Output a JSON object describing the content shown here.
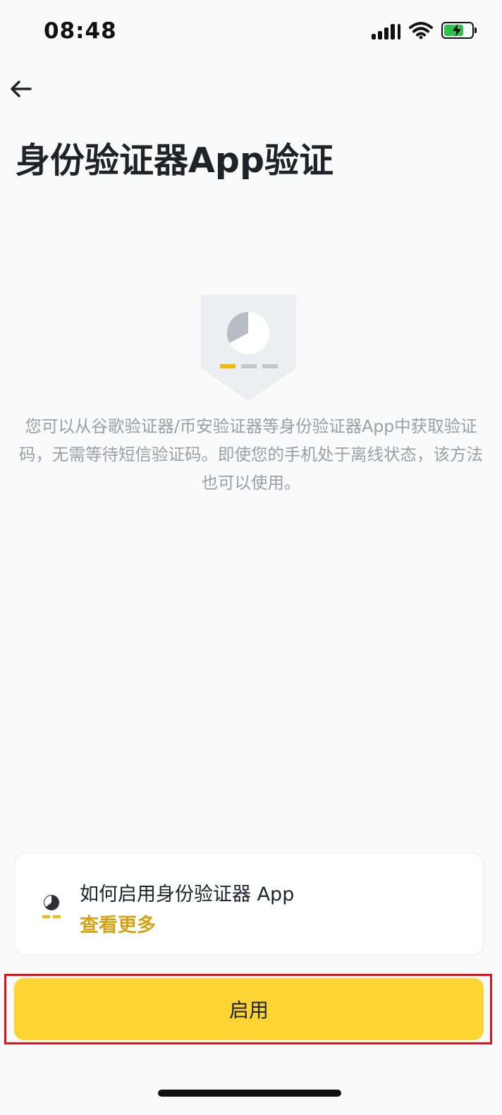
{
  "status_bar": {
    "time": "08:48",
    "icons": [
      "signal-icon",
      "wifi-icon",
      "battery-charging-icon"
    ],
    "battery_fill_fraction": 0.7,
    "battery_color": "#2fc24b"
  },
  "nav": {
    "back_icon": "arrow-left-icon"
  },
  "page": {
    "title": "身份验证器App验证",
    "description": "您可以从谷歌验证器/币安验证器等身份验证器App中获取验证码，无需等待短信验证码。即使您的手机处于离线状态，该方法也可以使用。"
  },
  "help_card": {
    "icon": "authenticator-guide-icon",
    "title": "如何启用身份验证器 App",
    "link_label": "查看更多"
  },
  "primary_action": {
    "label": "启用"
  },
  "colors": {
    "accent_yellow": "#fcd535",
    "link_gold": "#d4a414",
    "highlight_red": "#e5111b",
    "text_primary": "#1e2329",
    "text_secondary": "#9a9ea5"
  }
}
